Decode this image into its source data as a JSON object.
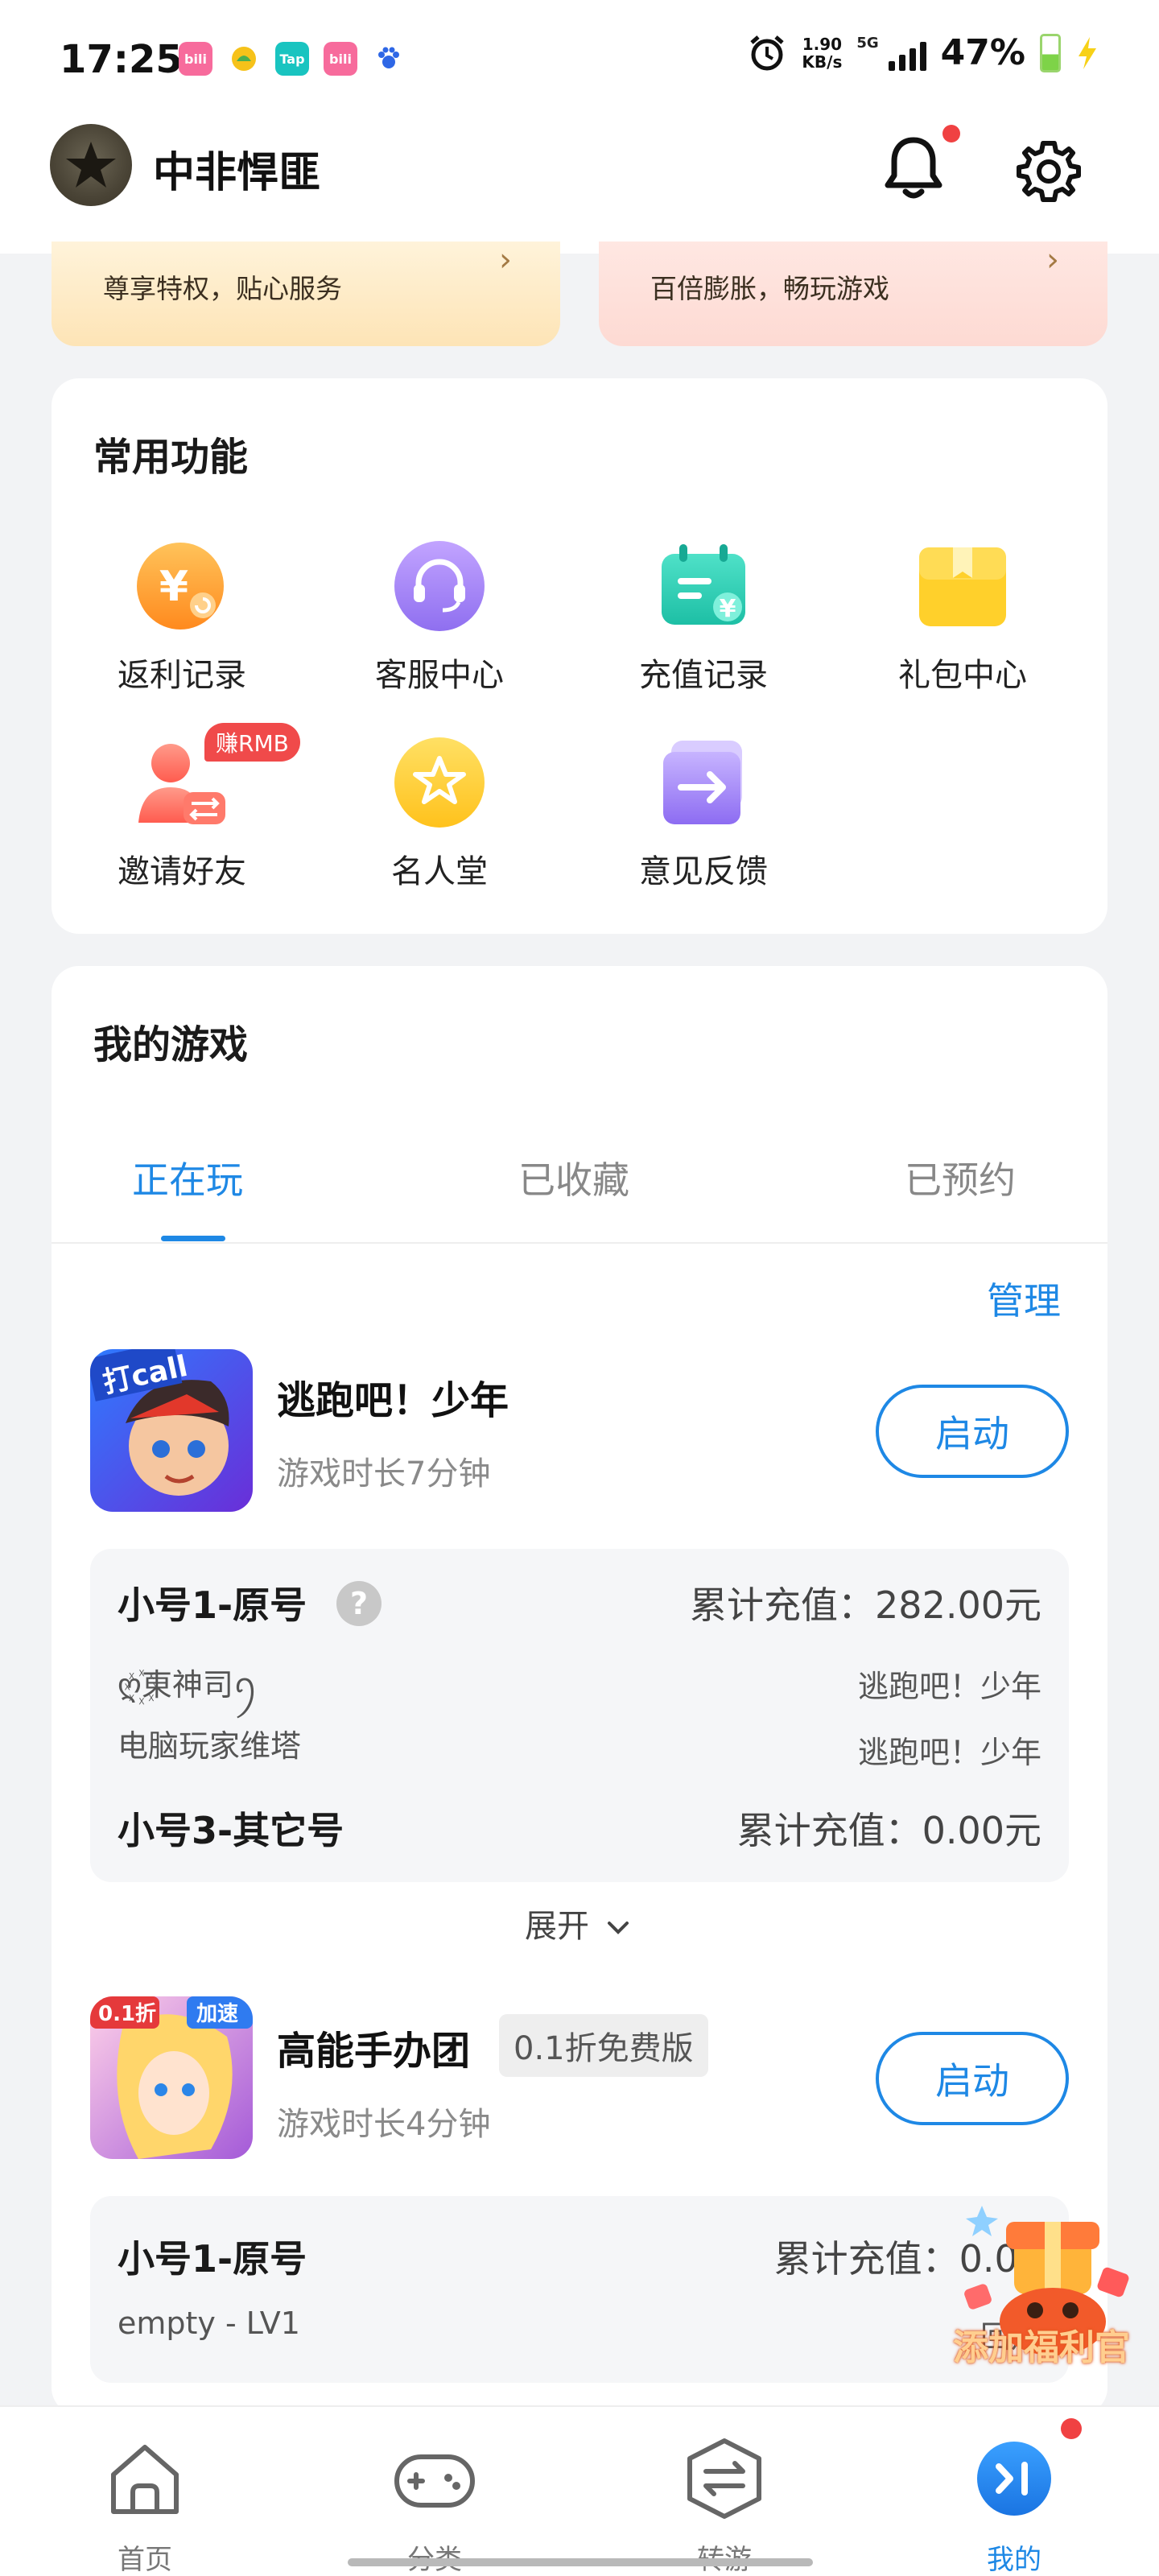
{
  "status_bar": {
    "time": "17:25",
    "app_icons": [
      "bilibili",
      "mango",
      "Tap",
      "bilibili",
      "baidu-paw"
    ],
    "net_speed_value": "1.90",
    "net_speed_unit": "KB/s",
    "network": "5G",
    "battery": "47%"
  },
  "header": {
    "username": "中非悍匪",
    "has_notification": true
  },
  "promos": [
    {
      "text": "尊享特权，贴心服务"
    },
    {
      "text": "百倍膨胀，畅玩游戏"
    }
  ],
  "functions": {
    "title": "常用功能",
    "items": [
      {
        "label": "返利记录",
        "icon": "rebate-icon"
      },
      {
        "label": "客服中心",
        "icon": "customer-service-icon"
      },
      {
        "label": "充值记录",
        "icon": "recharge-record-icon"
      },
      {
        "label": "礼包中心",
        "icon": "gift-icon"
      },
      {
        "label": "邀请好友",
        "icon": "invite-icon",
        "badge": "赚RMB"
      },
      {
        "label": "名人堂",
        "icon": "hall-of-fame-icon"
      },
      {
        "label": "意见反馈",
        "icon": "feedback-icon"
      }
    ]
  },
  "my_games": {
    "title": "我的游戏",
    "tabs": [
      "正在玩",
      "已收藏",
      "已预约"
    ],
    "active_tab": 0,
    "manage_label": "管理",
    "expand_label": "展开",
    "games": [
      {
        "name": "逃跑吧！少年",
        "play_time": "游戏时长7分钟",
        "launch_label": "启动",
        "icon_badge": "打call",
        "accounts": [
          {
            "title": "小号1-原号",
            "charge": "累计充值：282.00元",
            "roles": [
              {
                "role": "ღ꙰東神司ꪆ",
                "game": "逃跑吧！少年"
              },
              {
                "role": "电脑玩家维塔",
                "game": "逃跑吧！少年"
              }
            ]
          },
          {
            "title": "小号3-其它号",
            "charge": "累计充值：0.00元"
          }
        ]
      },
      {
        "name": "高能手办团",
        "tag": "0.1折免费版",
        "play_time": "游戏时长4分钟",
        "launch_label": "启动",
        "icon_badge_left": "0.1折",
        "icon_badge_right": "加速",
        "accounts": [
          {
            "title": "小号1-原号",
            "charge": "累计充值：0.00",
            "roles": [
              {
                "role": "empty - LV1",
                "game": "回声"
              }
            ]
          }
        ]
      }
    ]
  },
  "welfare": {
    "label": "添加福利官"
  },
  "bottom_nav": [
    {
      "label": "首页",
      "icon": "home-icon"
    },
    {
      "label": "分类",
      "icon": "gamepad-icon"
    },
    {
      "label": "转游",
      "icon": "transfer-icon"
    },
    {
      "label": "我的",
      "icon": "profile-icon",
      "active": true,
      "has_dot": true
    }
  ],
  "colors": {
    "accent": "#1e88e5",
    "badge_red": "#f04142",
    "background": "#f2f3f5"
  }
}
